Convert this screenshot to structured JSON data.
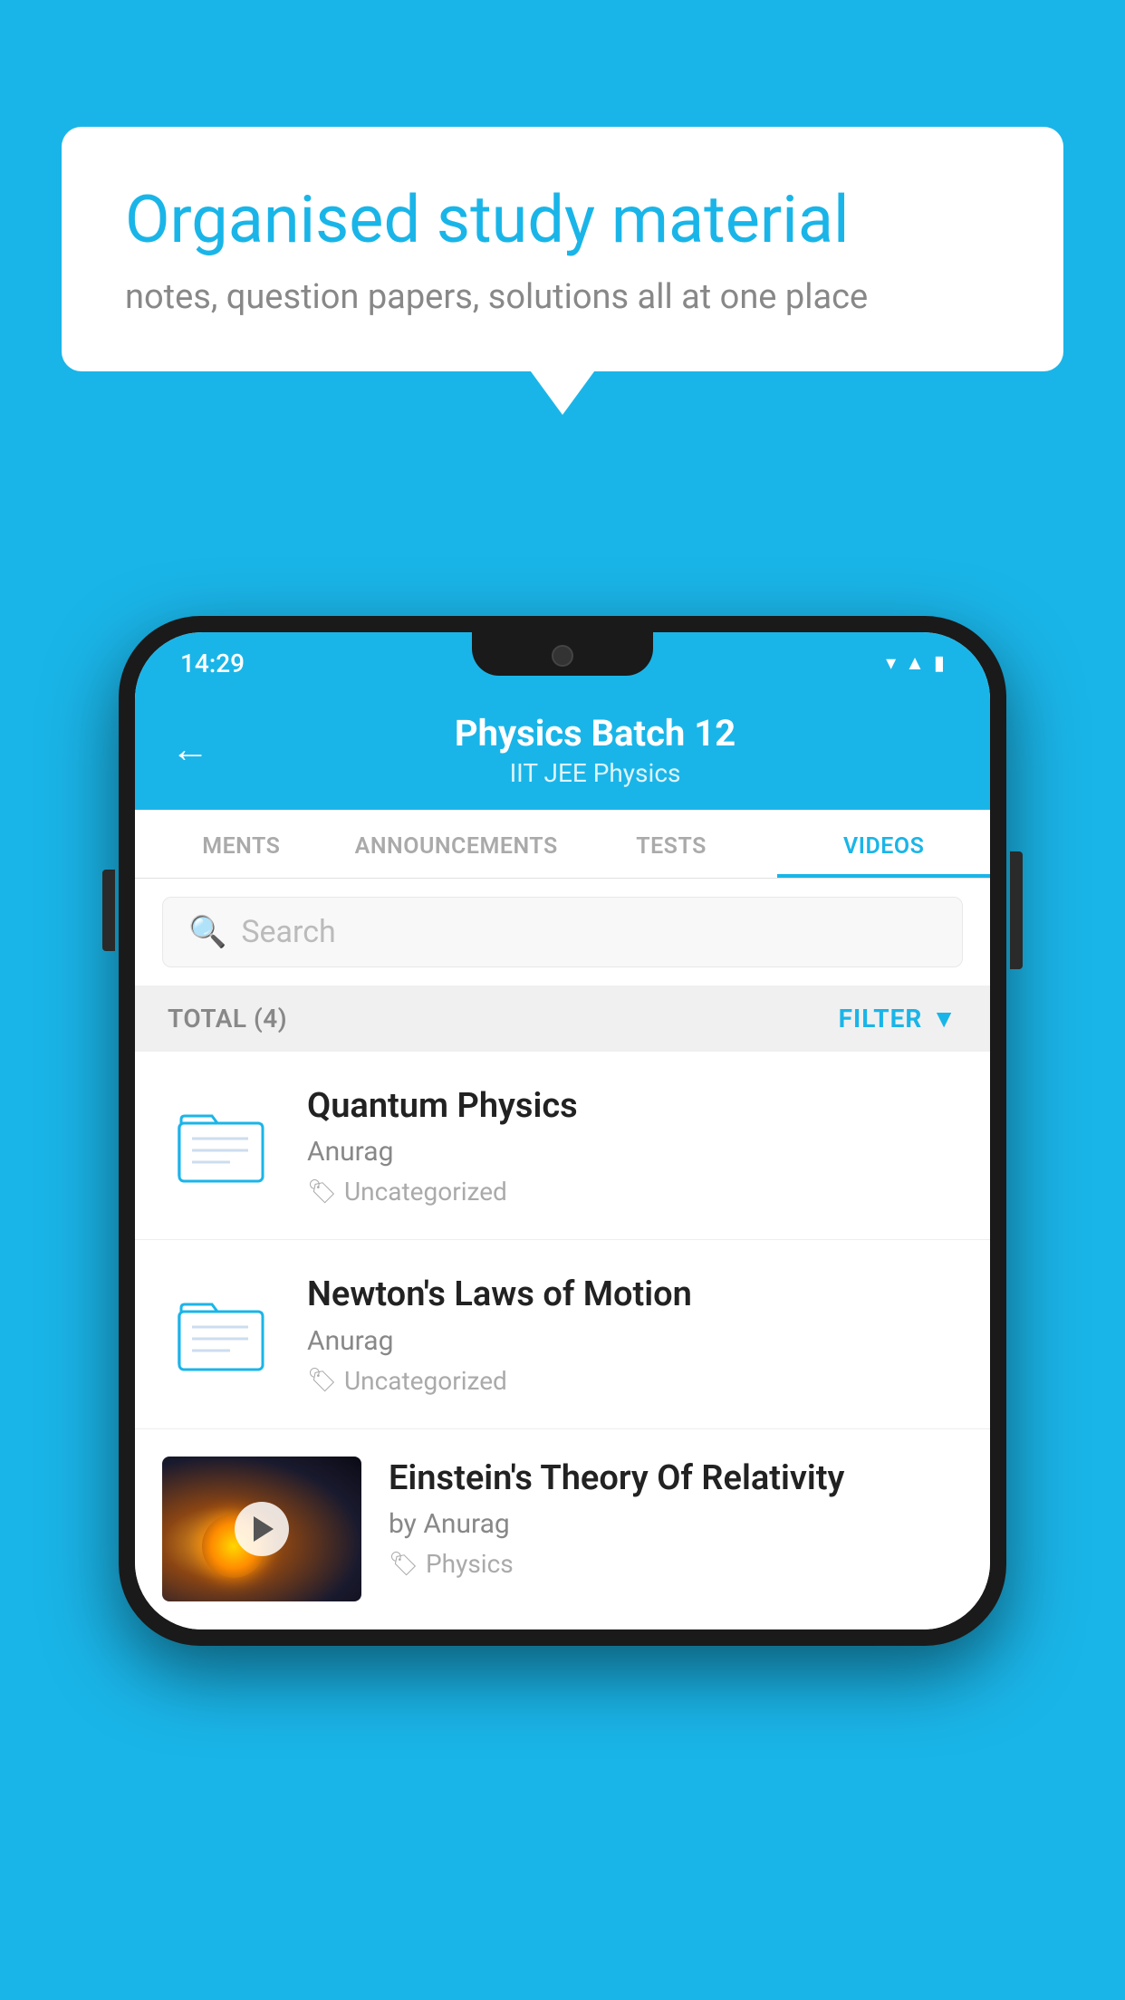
{
  "background": {
    "color": "#1ab5e8"
  },
  "speech_bubble": {
    "title": "Organised study material",
    "subtitle": "notes, question papers, solutions all at one place"
  },
  "status_bar": {
    "time": "14:29",
    "icons": [
      "wifi",
      "signal",
      "battery"
    ]
  },
  "header": {
    "back_label": "←",
    "title": "Physics Batch 12",
    "subtitle": "IIT JEE   Physics"
  },
  "tabs": [
    {
      "label": "MENTS",
      "active": false
    },
    {
      "label": "ANNOUNCEMENTS",
      "active": false
    },
    {
      "label": "TESTS",
      "active": false
    },
    {
      "label": "VIDEOS",
      "active": true
    }
  ],
  "search": {
    "placeholder": "Search"
  },
  "filter_bar": {
    "total_label": "TOTAL (4)",
    "filter_label": "FILTER"
  },
  "videos": [
    {
      "type": "folder",
      "title": "Quantum Physics",
      "author": "Anurag",
      "tag": "Uncategorized"
    },
    {
      "type": "folder",
      "title": "Newton's Laws of Motion",
      "author": "Anurag",
      "tag": "Uncategorized"
    },
    {
      "type": "thumbnail",
      "title": "Einstein's Theory Of Relativity",
      "author": "by Anurag",
      "tag": "Physics"
    }
  ]
}
